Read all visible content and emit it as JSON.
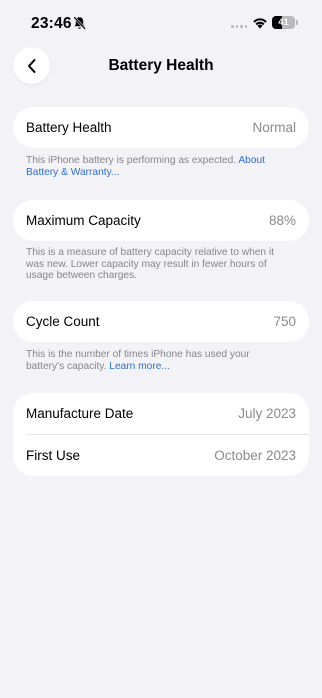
{
  "status_bar": {
    "time": "23:46",
    "battery_level": "41"
  },
  "nav": {
    "title": "Battery Health",
    "back_icon": "chevron-left-icon"
  },
  "battery_health": {
    "label": "Battery Health",
    "value": "Normal",
    "note_text": "This iPhone battery is performing as expected. ",
    "note_link": "About Battery & Warranty..."
  },
  "maximum_capacity": {
    "label": "Maximum Capacity",
    "value": "88%",
    "note_text": "This is a measure of battery capacity relative to when it was new. Lower capacity may result in fewer hours of usage between charges."
  },
  "cycle_count": {
    "label": "Cycle Count",
    "value": "750",
    "note_text": "This is the number of times iPhone has used your battery's capacity. ",
    "note_link": "Learn more..."
  },
  "dates": {
    "manufacture_label": "Manufacture Date",
    "manufacture_value": "July 2023",
    "first_use_label": "First Use",
    "first_use_value": "October 2023"
  },
  "colors": {
    "background": "#f2f2f7",
    "card": "#ffffff",
    "link": "#2f6fce",
    "secondary_text": "#8a8a8e"
  }
}
